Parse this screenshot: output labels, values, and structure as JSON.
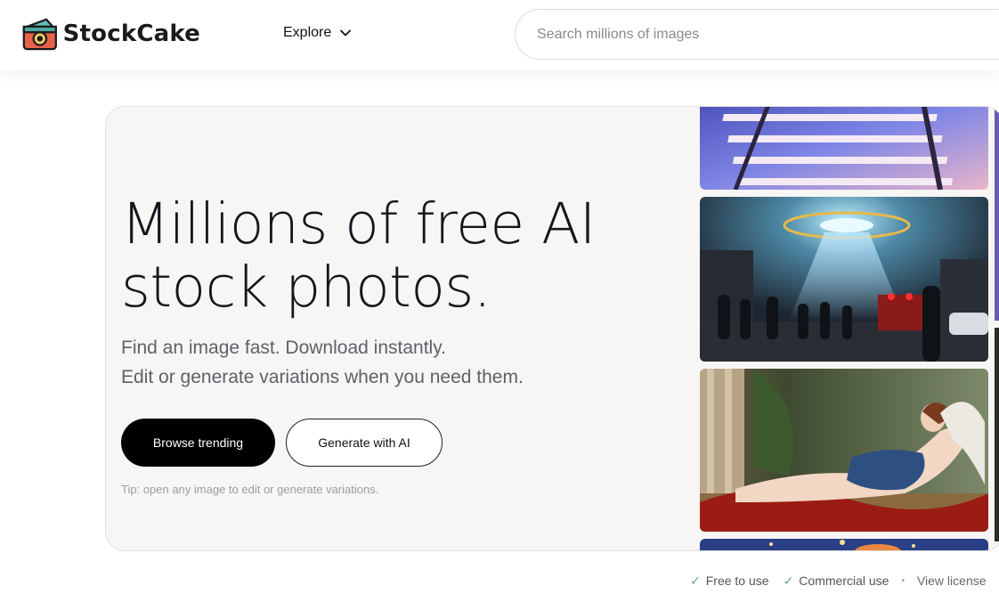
{
  "header": {
    "brand": "StockCake",
    "explore_label": "Explore",
    "search_placeholder": "Search millions of images"
  },
  "hero": {
    "headline_line1": "Millions of free AI",
    "headline_line2": "stock photos.",
    "sub_line1": "Find an image fast. Download instantly.",
    "sub_line2": "Edit or generate variations when you need them.",
    "primary_button": "Browse trending",
    "secondary_button": "Generate with AI",
    "tip": "Tip: open any image to edit or generate variations."
  },
  "photos": [
    {
      "subject": "snowy railway tracks at dusk"
    },
    {
      "subject": "UFO hovering over crowded city street at night"
    },
    {
      "subject": "classical painting of reclining woman on drapery"
    },
    {
      "subject": "starry night sky scene"
    }
  ],
  "footer": {
    "free": "Free to use",
    "commercial": "Commercial use",
    "license": "View license"
  },
  "colors": {
    "hero_bg": "#f7f6f4",
    "primary_button_bg": "#000000",
    "check_green": "#6aa89a",
    "headline": "#15161d"
  }
}
